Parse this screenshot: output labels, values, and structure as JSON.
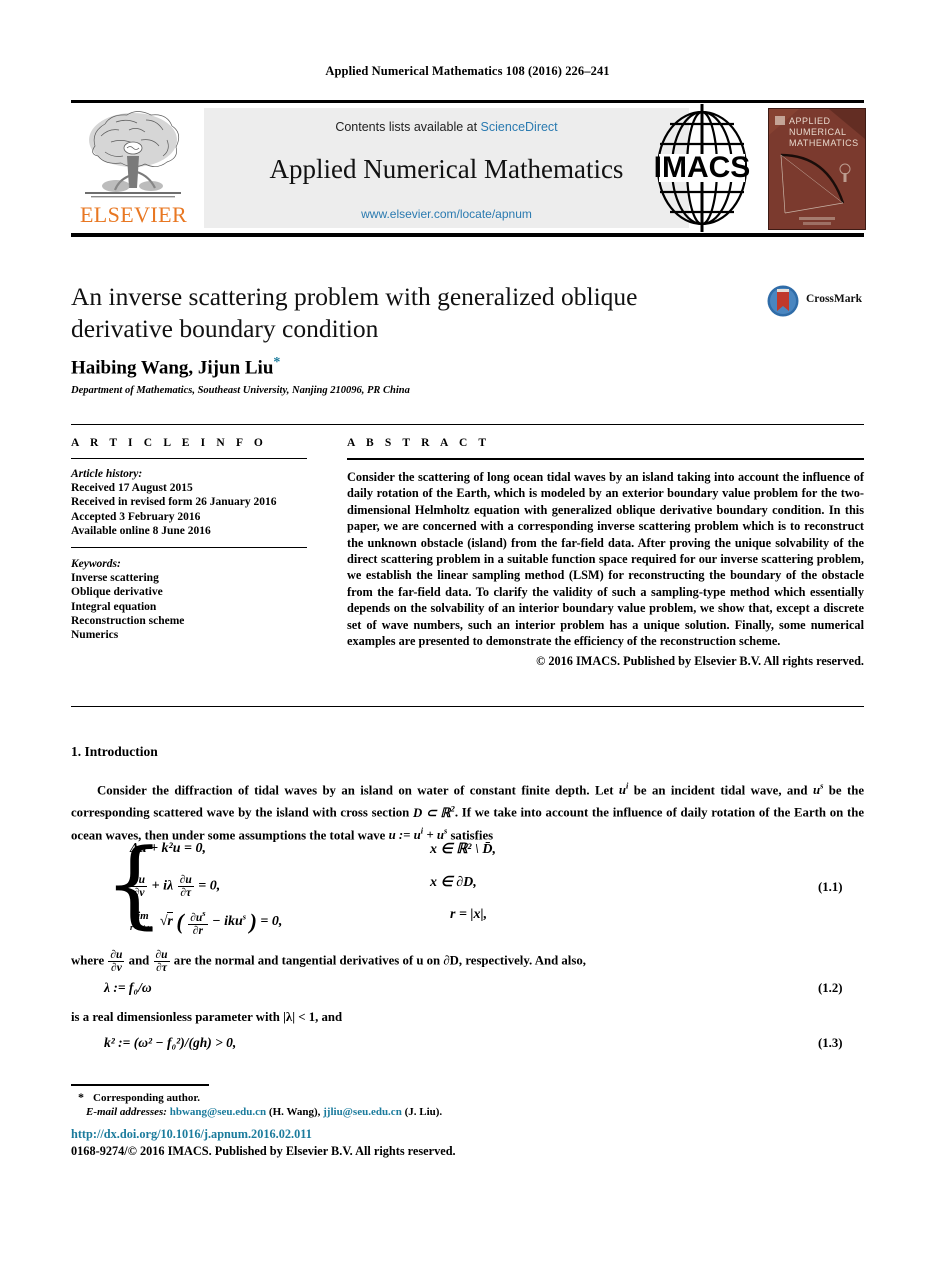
{
  "running_head": "Applied Numerical Mathematics 108 (2016) 226–241",
  "masthead": {
    "publisher_name": "ELSEVIER",
    "publisher_logo_name": "elsevier-tree-logo",
    "contents_prefix": "Contents lists available at ",
    "contents_link": "ScienceDirect",
    "journal_name": "Applied Numerical Mathematics",
    "journal_url": "www.elsevier.com/locate/apnum",
    "society_logo_text": "IMACS",
    "cover_title_line1": "APPLIED",
    "cover_title_line2": "NUMERICAL",
    "cover_title_line3": "MATHEMATICS"
  },
  "article": {
    "title": "An inverse scattering problem with generalized oblique derivative boundary condition",
    "authors": "Haibing Wang, Jijun Liu",
    "author_star": "*",
    "affiliation": "Department of Mathematics, Southeast University, Nanjing 210096, PR China",
    "crossmark_label": "CrossMark"
  },
  "info": {
    "heading": "A R T I C L E   I N F O",
    "history_label": "Article history:",
    "history": [
      "Received 17 August 2015",
      "Received in revised form 26 January 2016",
      "Accepted 3 February 2016",
      "Available online 8 June 2016"
    ],
    "keywords_label": "Keywords:",
    "keywords": [
      "Inverse scattering",
      "Oblique derivative",
      "Integral equation",
      "Reconstruction scheme",
      "Numerics"
    ]
  },
  "abstract": {
    "heading": "A B S T R A C T",
    "text": "Consider the scattering of long ocean tidal waves by an island taking into account the influence of daily rotation of the Earth, which is modeled by an exterior boundary value problem for the two-dimensional Helmholtz equation with generalized oblique derivative boundary condition. In this paper, we are concerned with a corresponding inverse scattering problem which is to reconstruct the unknown obstacle (island) from the far-field data. After proving the unique solvability of the direct scattering problem in a suitable function space required for our inverse scattering problem, we establish the linear sampling method (LSM) for reconstructing the boundary of the obstacle from the far-field data. To clarify the validity of such a sampling-type method which essentially depends on the solvability of an interior boundary value problem, we show that, except a discrete set of wave numbers, such an interior problem has a unique solution. Finally, some numerical examples are presented to demonstrate the efficiency of the reconstruction scheme.",
    "copyright": "© 2016 IMACS. Published by Elsevier B.V. All rights reserved."
  },
  "body": {
    "section_number_title": "1. Introduction",
    "paragraph_parts": {
      "p1": "Consider the diffraction of tidal waves by an island on water of constant finite depth. Let ",
      "p2": " be an incident tidal wave, and ",
      "p3": " be the corresponding scattered wave by the island with cross section ",
      "p4": ". If we take into account the influence of daily rotation of the Earth on the ocean waves, then under some assumptions the total wave ",
      "p5": " satisfies"
    },
    "where_line_1": "where ",
    "where_line_2": " and ",
    "where_line_3": " are the normal and tangential derivatives of u on ∂D, respectively. And also,",
    "param_line": "is a real dimensionless parameter with |λ| < 1, and",
    "eq_numbers": {
      "e11": "(1.1)",
      "e12": "(1.2)",
      "e13": "(1.3)"
    },
    "equations": {
      "line1_lhs": "Δu + k²u = 0,",
      "line1_rhs": "x ∈ ℝ² \\ D̄,",
      "line2_rhs": "x ∈ ∂D,",
      "line3_rhs": "r = |x|,",
      "eq12": "λ := f₀/ω",
      "eq13": "k² := (ω² − f₀²)/(gh) > 0,"
    }
  },
  "footnote": {
    "star": "*",
    "corresponding": "Corresponding author.",
    "email_label": "E-mail addresses:",
    "email1": "hbwang@seu.edu.cn",
    "email1_who": "(H. Wang),",
    "email2": "jjliu@seu.edu.cn",
    "email2_who": "(J. Liu).",
    "doi": "http://dx.doi.org/10.1016/j.apnum.2016.02.011",
    "issn_line": "0168-9274/© 2016 IMACS. Published by Elsevier B.V. All rights reserved."
  },
  "colors": {
    "link": "#1b7b9c",
    "science_direct": "#2a7ab0",
    "elsevier_orange": "#E87722",
    "cover_bg": "#7b3a2e",
    "masthead_bg": "#ededed"
  }
}
